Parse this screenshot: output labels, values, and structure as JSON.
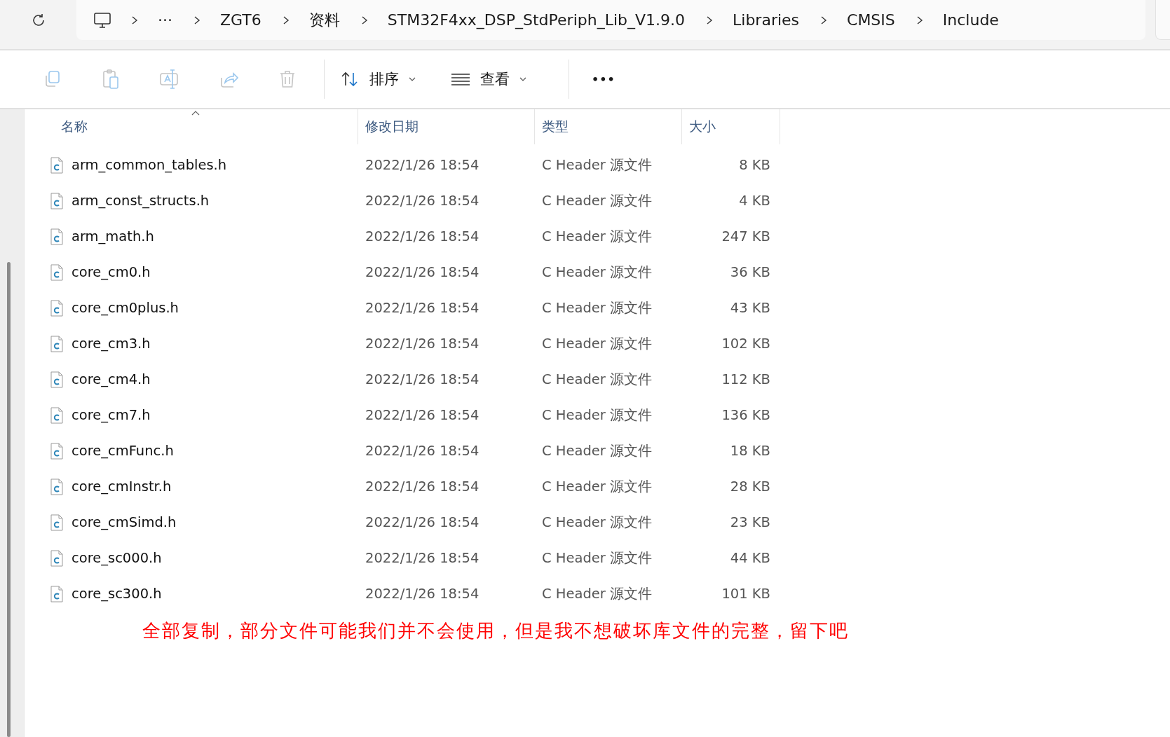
{
  "breadcrumb": {
    "overflow": "···",
    "items": [
      "ZGT6",
      "资料",
      "STM32F4xx_DSP_StdPeriph_Lib_V1.9.0",
      "Libraries",
      "CMSIS",
      "Include"
    ]
  },
  "toolbar": {
    "actions": [
      {
        "kind": "copy",
        "disabled": true
      },
      {
        "kind": "paste",
        "disabled": true
      },
      {
        "kind": "rename",
        "disabled": true
      },
      {
        "kind": "share",
        "disabled": true
      },
      {
        "kind": "delete",
        "disabled": true
      }
    ],
    "sort": "排序",
    "view": "查看",
    "more": "•••"
  },
  "table": {
    "columns": [
      {
        "label": "名称",
        "sorted": true
      },
      {
        "label": "修改日期",
        "sorted": false
      },
      {
        "label": "类型",
        "sorted": false
      },
      {
        "label": "大小",
        "sorted": false
      }
    ],
    "rows": [
      {
        "name": "arm_common_tables.h",
        "date": "2022/1/26 18:54",
        "type": "C Header 源文件",
        "size": "8 KB"
      },
      {
        "name": "arm_const_structs.h",
        "date": "2022/1/26 18:54",
        "type": "C Header 源文件",
        "size": "4 KB"
      },
      {
        "name": "arm_math.h",
        "date": "2022/1/26 18:54",
        "type": "C Header 源文件",
        "size": "247 KB"
      },
      {
        "name": "core_cm0.h",
        "date": "2022/1/26 18:54",
        "type": "C Header 源文件",
        "size": "36 KB"
      },
      {
        "name": "core_cm0plus.h",
        "date": "2022/1/26 18:54",
        "type": "C Header 源文件",
        "size": "43 KB"
      },
      {
        "name": "core_cm3.h",
        "date": "2022/1/26 18:54",
        "type": "C Header 源文件",
        "size": "102 KB"
      },
      {
        "name": "core_cm4.h",
        "date": "2022/1/26 18:54",
        "type": "C Header 源文件",
        "size": "112 KB"
      },
      {
        "name": "core_cm7.h",
        "date": "2022/1/26 18:54",
        "type": "C Header 源文件",
        "size": "136 KB"
      },
      {
        "name": "core_cmFunc.h",
        "date": "2022/1/26 18:54",
        "type": "C Header 源文件",
        "size": "18 KB"
      },
      {
        "name": "core_cmInstr.h",
        "date": "2022/1/26 18:54",
        "type": "C Header 源文件",
        "size": "28 KB"
      },
      {
        "name": "core_cmSimd.h",
        "date": "2022/1/26 18:54",
        "type": "C Header 源文件",
        "size": "23 KB"
      },
      {
        "name": "core_sc000.h",
        "date": "2022/1/26 18:54",
        "type": "C Header 源文件",
        "size": "44 KB"
      },
      {
        "name": "core_sc300.h",
        "date": "2022/1/26 18:54",
        "type": "C Header 源文件",
        "size": "101 KB"
      }
    ]
  },
  "annotation": "全部复制，部分文件可能我们并不会使用，但是我不想破坏库文件的完整，留下吧"
}
